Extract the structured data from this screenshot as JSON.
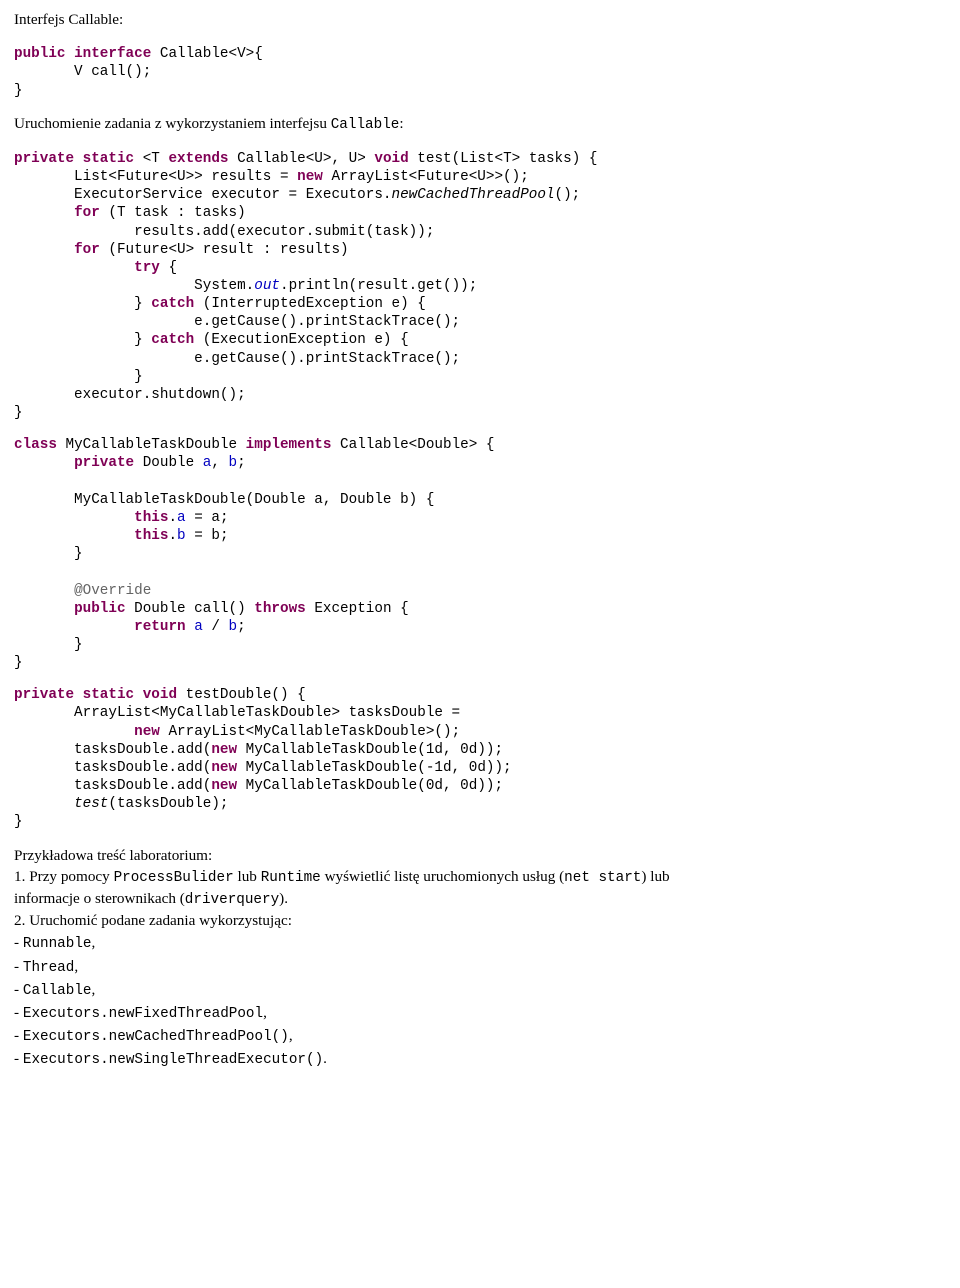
{
  "h_callable_title": "Interfejs Callable:",
  "code_callable_iface": {
    "l1a": "public",
    "l1b": " interface",
    "l1c": " Callable<V>{",
    "l2": "       V call();",
    "l3": "}"
  },
  "h_run_task": "Uruchomienie zadania z wykorzystaniem interfejsu ",
  "h_run_task_code": "Callable",
  "colon": ":",
  "code_test": {
    "l1_kw1": "private",
    "l1_kw2": " static",
    "l1_t1": " <T ",
    "l1_kw3": "extends",
    "l1_t2": " Callable<U>, U> ",
    "l1_kw4": "void",
    "l1_t3": " test(List<T> tasks) {",
    "l2_t1": "       List<Future<U>> results = ",
    "l2_kw1": "new",
    "l2_t2": " ArrayList<Future<U>>();",
    "l3_t1": "       ExecutorService executor = Executors.",
    "l3_it": "newCachedThreadPool",
    "l3_t2": "();",
    "l4_t0": "       ",
    "l4_kw1": "for",
    "l4_t1": " (T task : tasks)",
    "l5_t1": "              results.add(executor.submit(task));",
    "l6_t0": "       ",
    "l6_kw1": "for",
    "l6_t1": " (Future<U> result : results)",
    "l7_t0": "              ",
    "l7_kw1": "try",
    "l7_t1": " {",
    "l8_t0": "                     System.",
    "l8_out": "out",
    "l8_t1": ".println(result.get());",
    "l9_t0": "              } ",
    "l9_kw1": "catch",
    "l9_t1": " (InterruptedException e) {",
    "l10": "                     e.getCause().printStackTrace();",
    "l11_t0": "              } ",
    "l11_kw1": "catch",
    "l11_t1": " (ExecutionException e) {",
    "l12": "                     e.getCause().printStackTrace();",
    "l13": "              }",
    "l14": "       executor.shutdown();",
    "l15": "}"
  },
  "code_class": {
    "l1_kw1": "class",
    "l1_t1": " MyCallableTaskDouble ",
    "l1_kw2": "implements",
    "l1_t2": " Callable<Double> {",
    "l2_t0": "       ",
    "l2_kw1": "private",
    "l2_t1": " Double ",
    "l2_f1": "a",
    "l2_t2": ", ",
    "l2_f2": "b",
    "l2_t3": ";",
    "l3": "       MyCallableTaskDouble(Double a, Double b) {",
    "l4_t0": "              ",
    "l4_kw1": "this",
    "l4_t1": ".",
    "l4_f1": "a",
    "l4_t2": " = a;",
    "l5_t0": "              ",
    "l5_kw1": "this",
    "l5_t1": ".",
    "l5_f1": "b",
    "l5_t2": " = b;",
    "l6": "       }",
    "l7_t0": "       ",
    "l7_ann": "@Override",
    "l8_t0": "       ",
    "l8_kw1": "public",
    "l8_t1": " Double call() ",
    "l8_kw2": "throws",
    "l8_t2": " Exception {",
    "l9_t0": "              ",
    "l9_kw1": "return",
    "l9_t1": " ",
    "l9_f1": "a",
    "l9_t2": " / ",
    "l9_f2": "b",
    "l9_t3": ";",
    "l10": "       }",
    "l11": "}"
  },
  "code_testdouble": {
    "l1_kw1": "private",
    "l1_kw2": " static",
    "l1_kw3": " void",
    "l1_t1": " testDouble() {",
    "l2": "       ArrayList<MyCallableTaskDouble> tasksDouble =",
    "l3_t0": "              ",
    "l3_kw1": "new",
    "l3_t1": " ArrayList<MyCallableTaskDouble>();",
    "l4_t0": "       tasksDouble.add(",
    "l4_kw1": "new",
    "l4_t1": " MyCallableTaskDouble(1d, 0d));",
    "l5_t0": "       tasksDouble.add(",
    "l5_kw1": "new",
    "l5_t1": " MyCallableTaskDouble(-1d, 0d));",
    "l6_t0": "       tasksDouble.add(",
    "l6_kw1": "new",
    "l6_t1": " MyCallableTaskDouble(0d, 0d));",
    "l7_t0": "       ",
    "l7_it": "test",
    "l7_t1": "(tasksDouble);",
    "l8": "}"
  },
  "lab_title": "Przykładowa treść laboratorium:",
  "q1_a": "1. Przy pomocy ",
  "q1_code1": "ProcessBulider",
  "q1_b": " lub ",
  "q1_code2": "Runtime",
  "q1_c": " wyświetlić listę uruchomionych usług (",
  "q1_code3": "net start",
  "q1_d": ") lub",
  "q1_e": "informacje o sterownikach (",
  "q1_code4": "driverquery",
  "q1_f": ").",
  "q2": "2. Uruchomić podane zadania wykorzystując:",
  "li1": "- ",
  "li1c": "Runnable",
  "comma": ",",
  "li2": "- ",
  "li2c": "Thread",
  "li3": "- ",
  "li3c": "Callable",
  "li4": "- ",
  "li4c": "Executors.newFixedThreadPool",
  "li5": "- ",
  "li5c": "Executors.newCachedThreadPool()",
  "li6": "- ",
  "li6c": "Executors.newSingleThreadExecutor()",
  "period": "."
}
